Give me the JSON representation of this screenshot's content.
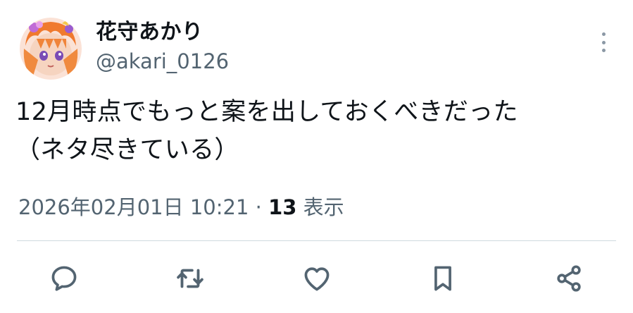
{
  "user": {
    "display_name": "花守あかり",
    "handle": "@akari_0126"
  },
  "tweet": {
    "line1": "12月時点でもっと案を出しておくべきだった",
    "line2": "（ネタ尽きている）"
  },
  "meta": {
    "timestamp": "2026年02月01日 10:21",
    "separator": "·",
    "views_count": "13",
    "views_label": "表示"
  },
  "actions": {
    "icons": [
      "reply-icon",
      "retweet-icon",
      "like-icon",
      "bookmark-icon",
      "share-icon"
    ]
  },
  "colors": {
    "primary_text": "#0f1419",
    "secondary_text": "#536471",
    "icon": "#536471",
    "divider": "#cfd9de"
  }
}
